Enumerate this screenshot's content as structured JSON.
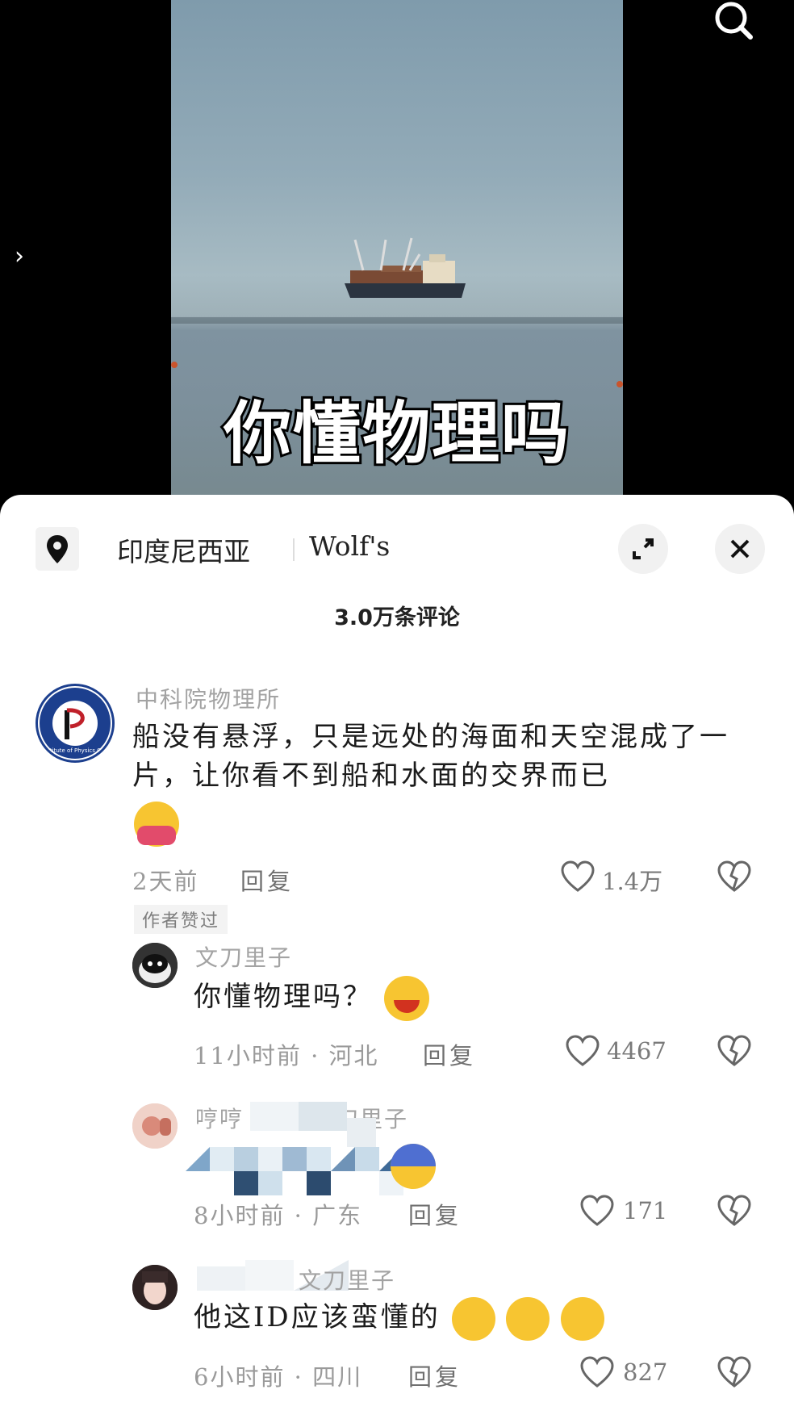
{
  "video": {
    "caption": "你懂物理吗"
  },
  "sheet": {
    "location": "印度尼西亚",
    "place": "Wolf's",
    "comment_count": "3.0万条评论"
  },
  "comments": [
    {
      "user": "中科院物理所",
      "text": "船没有悬浮，只是远处的海面和天空混成了一片，让你看不到船和水面的交界而已",
      "time": "2天前",
      "reply": "回复",
      "likes": "1.4万",
      "badge": "作者赞过",
      "avatar_text": "Institute of Physics CAS"
    },
    {
      "user": "文刀里子",
      "text": "你懂物理吗？",
      "time": "11小时前 · 河北",
      "reply": "回复",
      "likes": "4467"
    },
    {
      "user_visible": "哼哼",
      "user_tail": "刀里子",
      "time": "8小时前 · 广东",
      "reply": "回复",
      "likes": "171"
    },
    {
      "user_tail": "文刀里子",
      "text": "他这ID应该蛮懂的",
      "time": "6小时前 · 四川",
      "reply": "回复",
      "likes": "827"
    }
  ]
}
